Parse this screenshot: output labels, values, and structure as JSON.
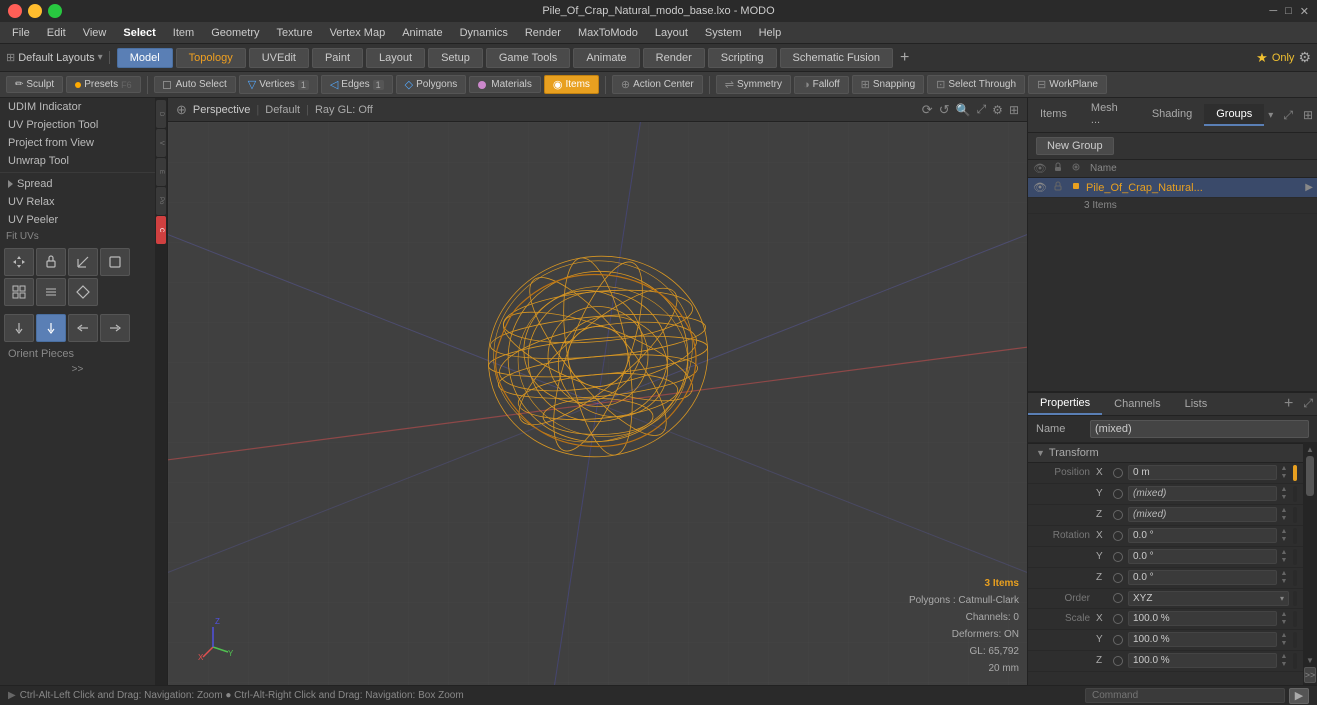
{
  "titlebar": {
    "title": "Pile_Of_Crap_Natural_modo_base.lxo - MODO",
    "controls": [
      "─",
      "□",
      "✕"
    ]
  },
  "menubar": {
    "items": [
      "File",
      "Edit",
      "View",
      "Select",
      "Item",
      "Geometry",
      "Texture",
      "Vertex Map",
      "Animate",
      "Dynamics",
      "Render",
      "MaxToModo",
      "Layout",
      "System",
      "Help"
    ]
  },
  "toolbar1": {
    "layouts_label": "Default Layouts",
    "tabs": [
      {
        "label": "Model",
        "active": true
      },
      {
        "label": "Topology"
      },
      {
        "label": "UVEdit"
      },
      {
        "label": "Paint"
      },
      {
        "label": "Layout"
      },
      {
        "label": "Setup"
      },
      {
        "label": "Game Tools"
      },
      {
        "label": "Animate"
      },
      {
        "label": "Render"
      },
      {
        "label": "Scripting"
      },
      {
        "label": "Schematic Fusion"
      }
    ],
    "plus_btn": "+",
    "only_btn": "Only",
    "gear_icon": "⚙"
  },
  "toolbar2": {
    "sculpt_btn": "Sculpt",
    "presets_btn": "Presets",
    "presets_shortcut": "F6",
    "auto_select_btn": "Auto Select",
    "vertices_btn": "Vertices",
    "vertices_count": "1",
    "edges_btn": "Edges",
    "edges_count": "1",
    "polygons_btn": "Polygons",
    "materials_btn": "Materials",
    "items_btn": "Items",
    "action_center_btn": "Action Center",
    "symmetry_btn": "Symmetry",
    "falloff_btn": "Falloff",
    "snapping_btn": "Snapping",
    "select_through_btn": "Select Through",
    "workplane_btn": "WorkPlane"
  },
  "left_sidebar": {
    "items": [
      {
        "label": "UDIM Indicator"
      },
      {
        "label": "UV Projection Tool"
      },
      {
        "label": "Project from View"
      },
      {
        "label": "Unwrap Tool"
      },
      {
        "label": "Spread"
      },
      {
        "label": "UV Relax"
      },
      {
        "label": "UV Peeler"
      },
      {
        "label": "Fit UVs"
      },
      {
        "label": "Orient Pieces"
      }
    ],
    "more_btn": ">>"
  },
  "viewport": {
    "perspective_label": "Perspective",
    "default_label": "Default",
    "raygl_label": "Ray GL: Off",
    "info": {
      "items": "3 Items",
      "polygons": "Polygons : Catmull-Clark",
      "channels": "Channels: 0",
      "deformers": "Deformers: ON",
      "gl": "GL: 65,792",
      "size": "20 mm"
    },
    "nav_hint": "Ctrl-Alt-Left Click and Drag: Navigation: Zoom ● Ctrl-Alt-Right Click and Drag: Navigation: Box Zoom"
  },
  "right_panel": {
    "tabs": [
      {
        "label": "Items"
      },
      {
        "label": "Mesh ..."
      },
      {
        "label": "Shading"
      },
      {
        "label": "Groups",
        "active": true
      }
    ],
    "new_group_btn": "New Group",
    "columns": {
      "eye": "👁",
      "name": "Name"
    },
    "groups": [
      {
        "name": "Pile_Of_Crap_Natural...",
        "count": "3 Items",
        "selected": true
      }
    ]
  },
  "properties_panel": {
    "tabs": [
      {
        "label": "Properties",
        "active": true
      },
      {
        "label": "Channels"
      },
      {
        "label": "Lists"
      }
    ],
    "add_btn": "+",
    "name_label": "Name",
    "name_value": "(mixed)",
    "transform_label": "Transform",
    "position_label": "Position",
    "rotation_label": "Rotation",
    "order_label": "Order",
    "scale_label": "Scale",
    "fields": [
      {
        "axis": "X",
        "label": "Position X",
        "value": "0 m"
      },
      {
        "axis": "Y",
        "label": "Position Y",
        "value": "(mixed)"
      },
      {
        "axis": "Z",
        "label": "Position Z",
        "value": "(mixed)"
      },
      {
        "axis": "X",
        "label": "Rotation X",
        "value": "0.0 °"
      },
      {
        "axis": "Y",
        "label": "Rotation Y",
        "value": "0.0 °"
      },
      {
        "axis": "Z",
        "label": "Rotation Z",
        "value": "0.0 °"
      },
      {
        "axis": "",
        "label": "Order",
        "value": "XYZ",
        "dropdown": true
      },
      {
        "axis": "X",
        "label": "Scale X",
        "value": "100.0 %"
      },
      {
        "axis": "Y",
        "label": "Scale Y",
        "value": "100.0 %"
      },
      {
        "axis": "Z",
        "label": "Scale Z",
        "value": "100.0 %"
      }
    ],
    "expand_btn": ">>"
  },
  "statusbar": {
    "text": "Ctrl-Alt-Left Click and Drag: Navigation: Zoom ● Ctrl-Alt-Right Click and Drag: Navigation: Box Zoom",
    "command_placeholder": "Command"
  }
}
